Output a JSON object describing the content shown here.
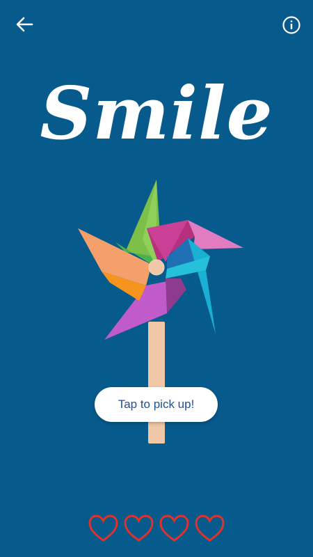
{
  "header": {
    "back_icon": "arrow-left-icon",
    "info_icon": "info-circle-icon"
  },
  "title": "Smile",
  "pickup_button": {
    "label": "Tap to pick up!"
  },
  "hearts": {
    "total": 4,
    "filled": 0,
    "icon": "heart-outline-icon",
    "color": "#e0322b"
  },
  "colors": {
    "background": "#075a8c",
    "title": "#ffffff",
    "button_text": "#1f4f8f"
  }
}
